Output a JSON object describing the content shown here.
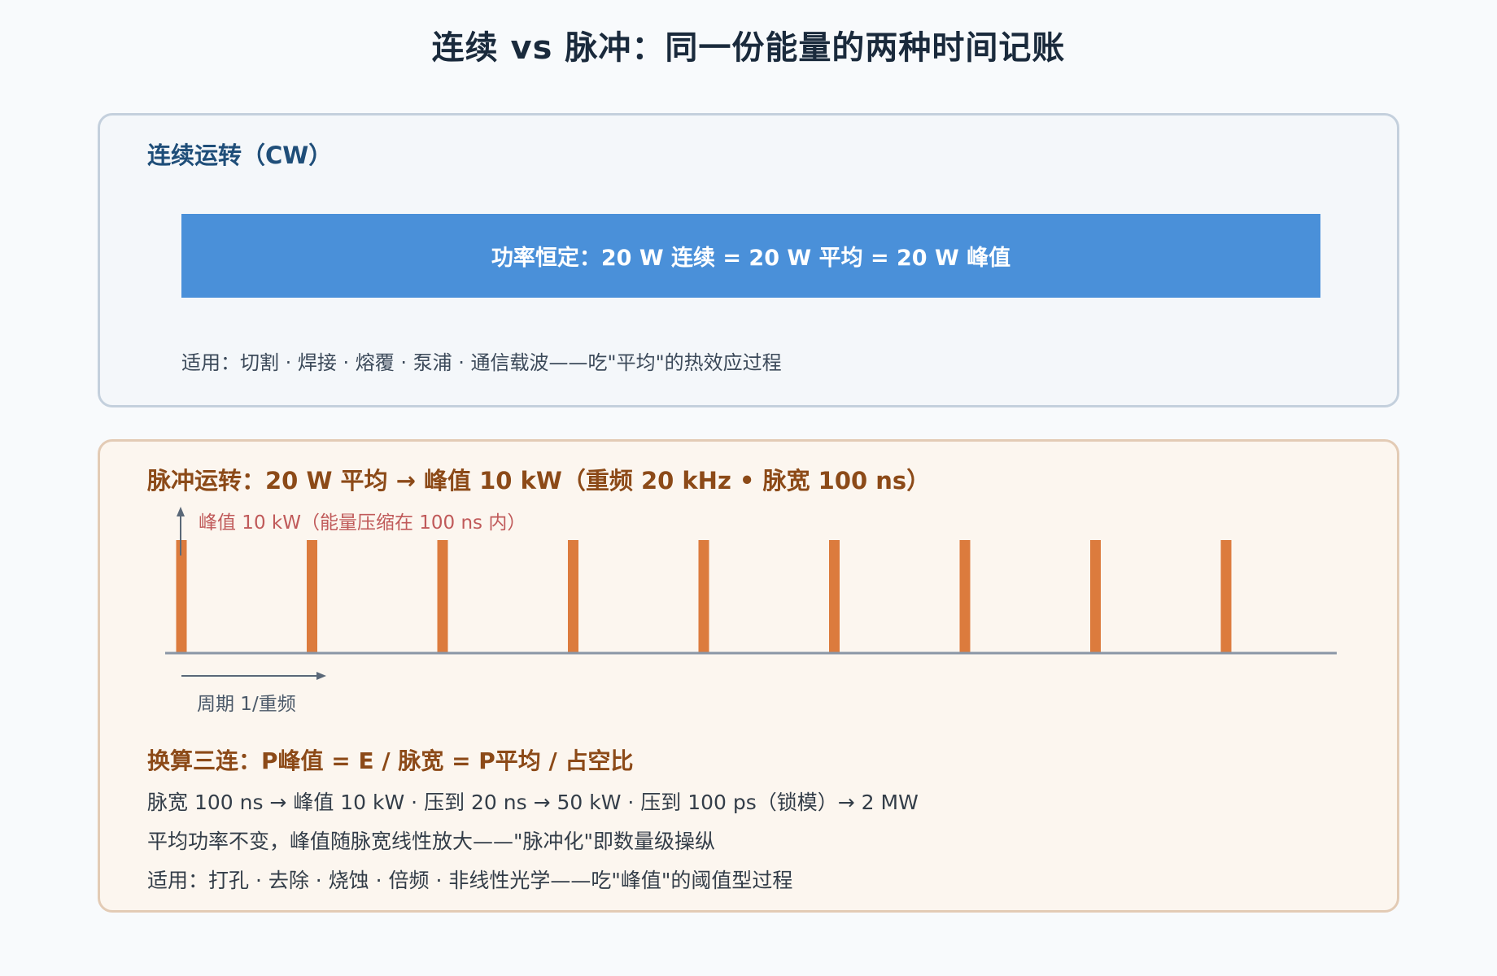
{
  "title": "连续 vs 脉冲：同一份能量的两种时间记账",
  "cw": {
    "heading": "连续运转（CW）",
    "bar_text": "功率恒定：20 W 连续 = 20 W 平均 = 20 W 峰值",
    "use": "适用：切割 · 焊接 · 熔覆 · 泵浦 · 通信载波——吃\"平均\"的热效应过程",
    "bar_color": "#4a90d9"
  },
  "pulse": {
    "heading": "脉冲运转：20 W 平均 → 峰值 10 kW（重频 20 kHz • 脉宽 100 ns）",
    "peak_note": "峰值 10 kW（能量压缩在 100 ns 内）",
    "period_label": "周期 1/重频",
    "pulse_count": 9,
    "pulse_color": "#dc7b3d",
    "formula": "换算三连：P峰值 = E / 脉宽 = P平均 / 占空比",
    "lines": [
      "脉宽 100 ns → 峰值 10 kW · 压到 20 ns → 50 kW · 压到 100 ps（锁模）→ 2 MW",
      "平均功率不变，峰值随脉宽线性放大——\"脉冲化\"即数量级操纵",
      "适用：打孔 · 去除 · 烧蚀 · 倍频 · 非线性光学——吃\"峰值\"的阈值型过程"
    ]
  }
}
